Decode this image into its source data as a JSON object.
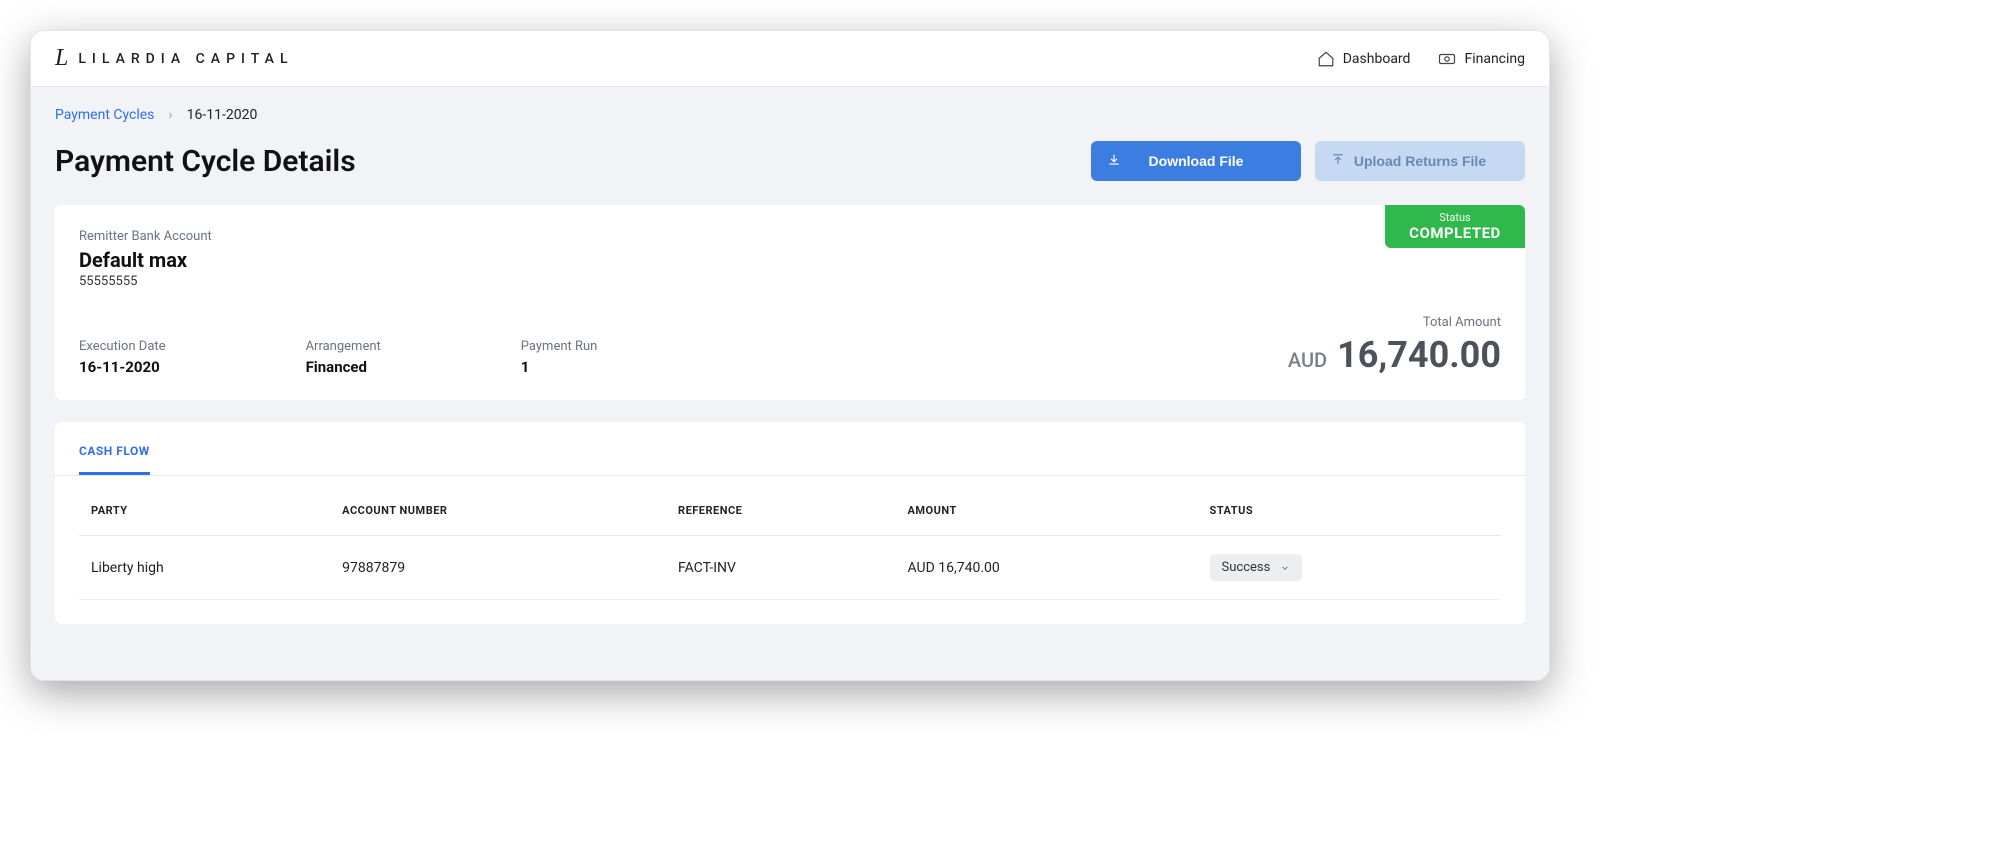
{
  "brand": {
    "logo_glyph": "L",
    "name": "LILARDIA CAPITAL"
  },
  "topnav": {
    "dashboard": "Dashboard",
    "financing": "Financing"
  },
  "breadcrumb": {
    "root": "Payment Cycles",
    "current": "16-11-2020"
  },
  "page_title": "Payment Cycle Details",
  "actions": {
    "download": "Download File",
    "upload": "Upload Returns File"
  },
  "summary": {
    "remitter_label": "Remitter Bank Account",
    "remitter_name": "Default max",
    "remitter_account": "55555555",
    "status_label": "Status",
    "status_value": "COMPLETED",
    "execution_date_label": "Execution Date",
    "execution_date_value": "16-11-2020",
    "arrangement_label": "Arrangement",
    "arrangement_value": "Financed",
    "payment_run_label": "Payment Run",
    "payment_run_value": "1",
    "total_label": "Total Amount",
    "total_currency": "AUD",
    "total_amount": "16,740.00"
  },
  "tabs": {
    "cash_flow": "CASH FLOW"
  },
  "table": {
    "headers": {
      "party": "PARTY",
      "account_number": "ACCOUNT NUMBER",
      "reference": "REFERENCE",
      "amount": "AMOUNT",
      "status": "STATUS"
    },
    "rows": [
      {
        "party": "Liberty high",
        "account_number": "97887879",
        "reference": "FACT-INV",
        "amount": "AUD 16,740.00",
        "status": "Success"
      }
    ]
  }
}
